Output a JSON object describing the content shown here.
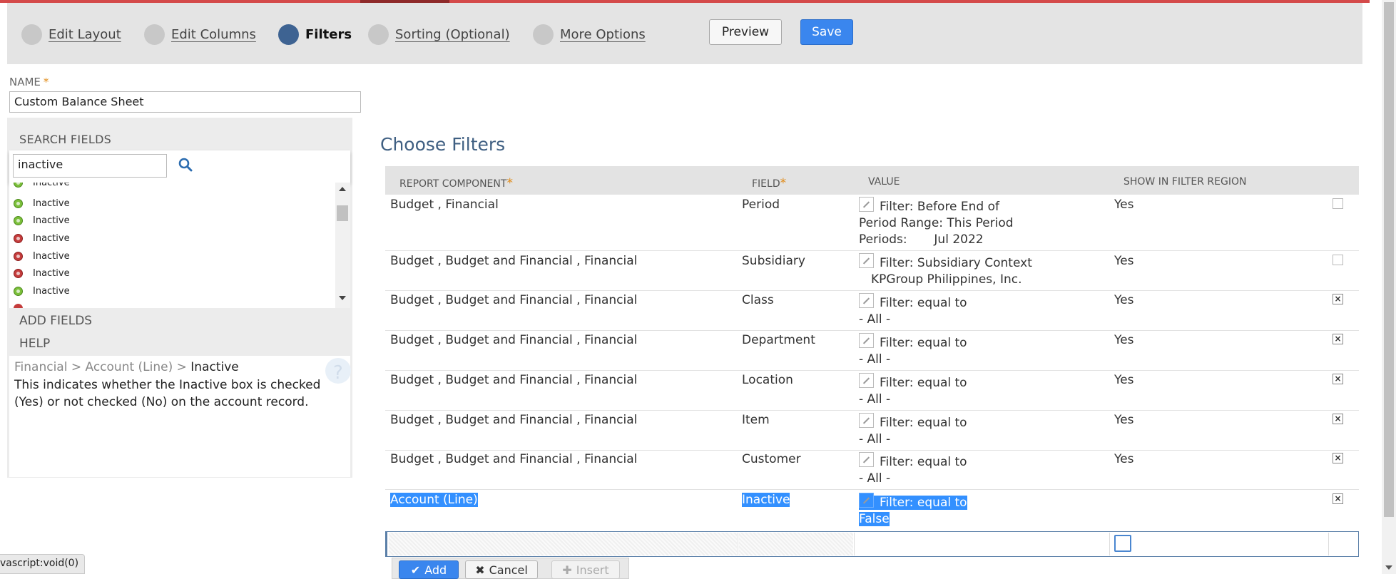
{
  "steps": [
    {
      "label": "Edit Layout",
      "active": false
    },
    {
      "label": "Edit Columns",
      "active": false
    },
    {
      "label": "Filters",
      "active": true
    },
    {
      "label": "Sorting (Optional)",
      "active": false
    },
    {
      "label": "More Options",
      "active": false
    }
  ],
  "toolbar": {
    "preview_label": "Preview",
    "save_label": "Save"
  },
  "name_field": {
    "label": "NAME",
    "required_mark": "*",
    "value": "Custom Balance Sheet"
  },
  "search_fields": {
    "title": "SEARCH FIELDS",
    "query": "inactive",
    "results": [
      {
        "label": "Inactive",
        "icon": "green-field-icon"
      },
      {
        "label": "Inactive",
        "icon": "green-field-icon"
      },
      {
        "label": "Inactive",
        "icon": "green-field-icon"
      },
      {
        "label": "Inactive",
        "icon": "red-field-icon"
      },
      {
        "label": "Inactive",
        "icon": "red-field-icon"
      },
      {
        "label": "Inactive",
        "icon": "red-field-icon"
      },
      {
        "label": "Inactive",
        "icon": "green-field-icon"
      }
    ]
  },
  "add_fields": {
    "title": "ADD FIELDS"
  },
  "help": {
    "title": "HELP",
    "path": "Financial > Account (Line) >",
    "path_current": "Inactive",
    "text": "This indicates whether the Inactive box is checked (Yes) or not checked (No) on the account record."
  },
  "filters": {
    "title": "Choose Filters",
    "columns": {
      "component": "REPORT COMPONENT",
      "field": "FIELD",
      "value": "VALUE",
      "show": "SHOW IN FILTER REGION",
      "required_mark": "*"
    },
    "rows": [
      {
        "component": "Budget , Financial",
        "field": "Period",
        "value_lines": [
          "Filter: Before End of",
          "Period Range: This Period",
          "Periods:       Jul 2022"
        ],
        "show": "Yes",
        "removable": false,
        "highlighted": false
      },
      {
        "component": "Budget , Budget and Financial , Financial",
        "field": "Subsidiary",
        "value_lines": [
          "Filter: Subsidiary Context",
          "KPGroup Philippines, Inc."
        ],
        "show": "Yes",
        "removable": false,
        "highlighted": false
      },
      {
        "component": "Budget , Budget and Financial , Financial",
        "field": "Class",
        "value_lines": [
          "Filter: equal to",
          "- All -"
        ],
        "show": "Yes",
        "removable": true,
        "highlighted": false
      },
      {
        "component": "Budget , Budget and Financial , Financial",
        "field": "Department",
        "value_lines": [
          "Filter: equal to",
          "- All -"
        ],
        "show": "Yes",
        "removable": true,
        "highlighted": false
      },
      {
        "component": "Budget , Budget and Financial , Financial",
        "field": "Location",
        "value_lines": [
          "Filter: equal to",
          "- All -"
        ],
        "show": "Yes",
        "removable": true,
        "highlighted": false
      },
      {
        "component": "Budget , Budget and Financial , Financial",
        "field": "Item",
        "value_lines": [
          "Filter: equal to",
          "- All -"
        ],
        "show": "Yes",
        "removable": true,
        "highlighted": false
      },
      {
        "component": "Budget , Budget and Financial , Financial",
        "field": "Customer",
        "value_lines": [
          "Filter: equal to",
          "- All -"
        ],
        "show": "Yes",
        "removable": true,
        "highlighted": false
      },
      {
        "component": "Account (Line)",
        "field": "Inactive",
        "value_lines": [
          "Filter: equal to",
          "False"
        ],
        "show": "",
        "removable": true,
        "highlighted": true
      }
    ],
    "actions": {
      "add": "Add",
      "cancel": "Cancel",
      "insert": "Insert"
    }
  },
  "status_bar": "vascript:void(0)",
  "colors": {
    "accent": "#3a86ee",
    "active_step": "#3e6392",
    "selection": "#3390ff",
    "title": "#3f5f82"
  }
}
